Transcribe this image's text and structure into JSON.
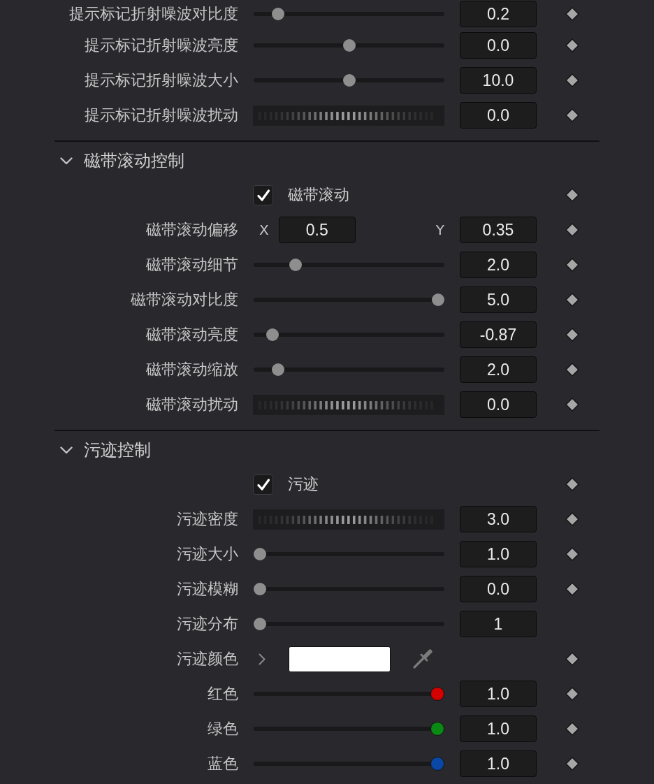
{
  "sections": [
    {
      "rows": [
        {
          "kind": "slider",
          "label": "提示标记折射噪波对比度",
          "level": 0.1,
          "value": "0.2",
          "keyframe": true
        },
        {
          "kind": "slider",
          "label": "提示标记折射噪波亮度",
          "level": 0.5,
          "value": "0.0",
          "keyframe": true
        },
        {
          "kind": "slider",
          "label": "提示标记折射噪波大小",
          "level": 0.5,
          "value": "10.0",
          "keyframe": true
        },
        {
          "kind": "wheel",
          "label": "提示标记折射噪波扰动",
          "value": "0.0",
          "keyframe": true
        }
      ]
    },
    {
      "title": "磁带滚动控制",
      "expanded": true,
      "rows": [
        {
          "kind": "checkbox",
          "label": "磁带滚动",
          "checked": true,
          "keyframe": true
        },
        {
          "kind": "offset",
          "label": "磁带滚动偏移",
          "x_label": "X",
          "x_value": "0.5",
          "y_label": "Y",
          "y_value": "0.35",
          "keyframe": true
        },
        {
          "kind": "slider",
          "label": "磁带滚动细节",
          "level": 0.2,
          "value": "2.0",
          "keyframe": true
        },
        {
          "kind": "slider",
          "label": "磁带滚动对比度",
          "level": 1,
          "value": "5.0",
          "keyframe": true
        },
        {
          "kind": "slider",
          "label": "磁带滚动亮度",
          "level": 0.07,
          "value": "-0.87",
          "keyframe": true
        },
        {
          "kind": "slider",
          "label": "磁带滚动缩放",
          "level": 0.1,
          "value": "2.0",
          "keyframe": true
        },
        {
          "kind": "wheel",
          "label": "磁带滚动扰动",
          "value": "0.0",
          "keyframe": true
        }
      ]
    },
    {
      "title": "污迹控制",
      "expanded": true,
      "rows": [
        {
          "kind": "checkbox",
          "label": "污迹",
          "checked": true,
          "keyframe": true
        },
        {
          "kind": "wheel",
          "label": "污迹密度",
          "value": "3.0",
          "keyframe": true
        },
        {
          "kind": "slider",
          "label": "污迹大小",
          "level": 0,
          "value": "1.0",
          "keyframe": true
        },
        {
          "kind": "slider",
          "label": "污迹模糊",
          "level": 0,
          "value": "0.0",
          "keyframe": true
        },
        {
          "kind": "slider",
          "label": "污迹分布",
          "level": 0,
          "value": "1",
          "keyframe": false
        },
        {
          "kind": "color",
          "label": "污迹颜色",
          "expanded": false,
          "color": "#ffffff",
          "keyframe": true
        },
        {
          "kind": "slider",
          "label": "红色",
          "level": 1,
          "value": "1.0",
          "color": "#d40000",
          "keyframe": true
        },
        {
          "kind": "slider",
          "label": "绿色",
          "level": 1,
          "value": "1.0",
          "color": "#0a8a14",
          "keyframe": true
        },
        {
          "kind": "slider",
          "label": "蓝色",
          "level": 1,
          "value": "1.0",
          "color": "#0a48a8",
          "keyframe": true
        }
      ]
    }
  ]
}
